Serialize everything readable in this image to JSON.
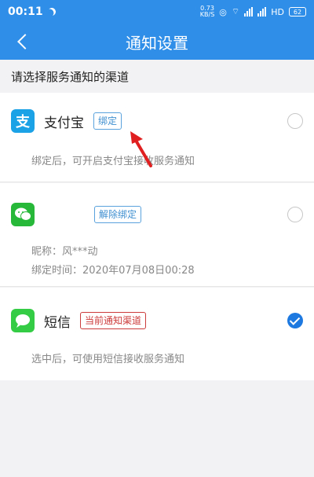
{
  "status": {
    "time": "00:11",
    "net_speed_top": "0.73",
    "net_speed_bottom": "KB/S",
    "battery": "62"
  },
  "header": {
    "title": "通知设置"
  },
  "section": {
    "title": "请选择服务通知的渠道"
  },
  "channels": {
    "alipay": {
      "name": "支付宝",
      "tag": "绑定",
      "desc": "绑定后，可开启支付宝接收服务通知",
      "icon_text": "支"
    },
    "wechat": {
      "name": "",
      "tag": "解除绑定",
      "nickname": "昵称：风***动",
      "bind_time": "绑定时间：2020年07月08日00:28"
    },
    "sms": {
      "name": "短信",
      "tag": "当前通知渠道",
      "desc": "选中后，可使用短信接收服务通知"
    }
  },
  "colors": {
    "primary": "#2f8fe8",
    "checked": "#1d79e0",
    "tag_blue": "#3f8fd0",
    "tag_red": "#cc3b3b"
  }
}
